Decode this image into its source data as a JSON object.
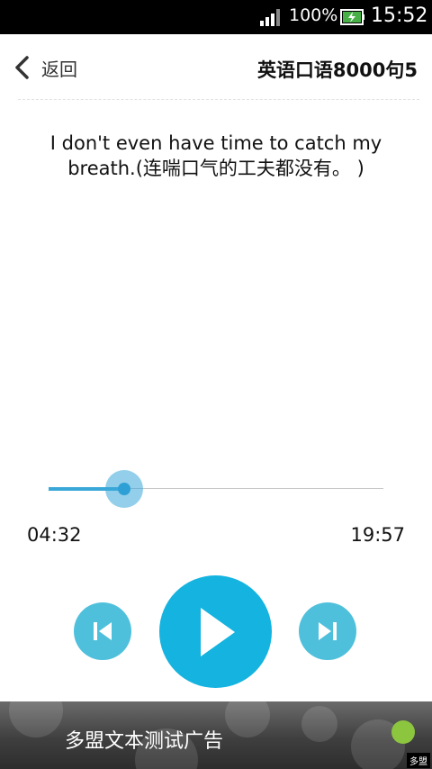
{
  "status_bar": {
    "battery_percent": "100%",
    "time": "15:52",
    "icons": [
      "signal-icon",
      "battery-charging-icon"
    ]
  },
  "header": {
    "back_label": "返回",
    "title": "英语口语8000句5"
  },
  "sentence": {
    "text": "I don't even have time to catch my breath.(连喘口气的工夫都没有。 )"
  },
  "player": {
    "elapsed": "04:32",
    "total": "19:57",
    "progress_fraction": 0.227,
    "controls": {
      "previous": "previous-track-icon",
      "play": "play-icon",
      "next": "next-track-icon"
    },
    "colors": {
      "accent": "#3aa7d9",
      "play_button": "#14b3e0",
      "side_buttons": "#4fc0dc"
    }
  },
  "ad": {
    "text": "多盟文本测试广告",
    "corner_label": "多盟",
    "dot_color": "#8cc63f"
  }
}
